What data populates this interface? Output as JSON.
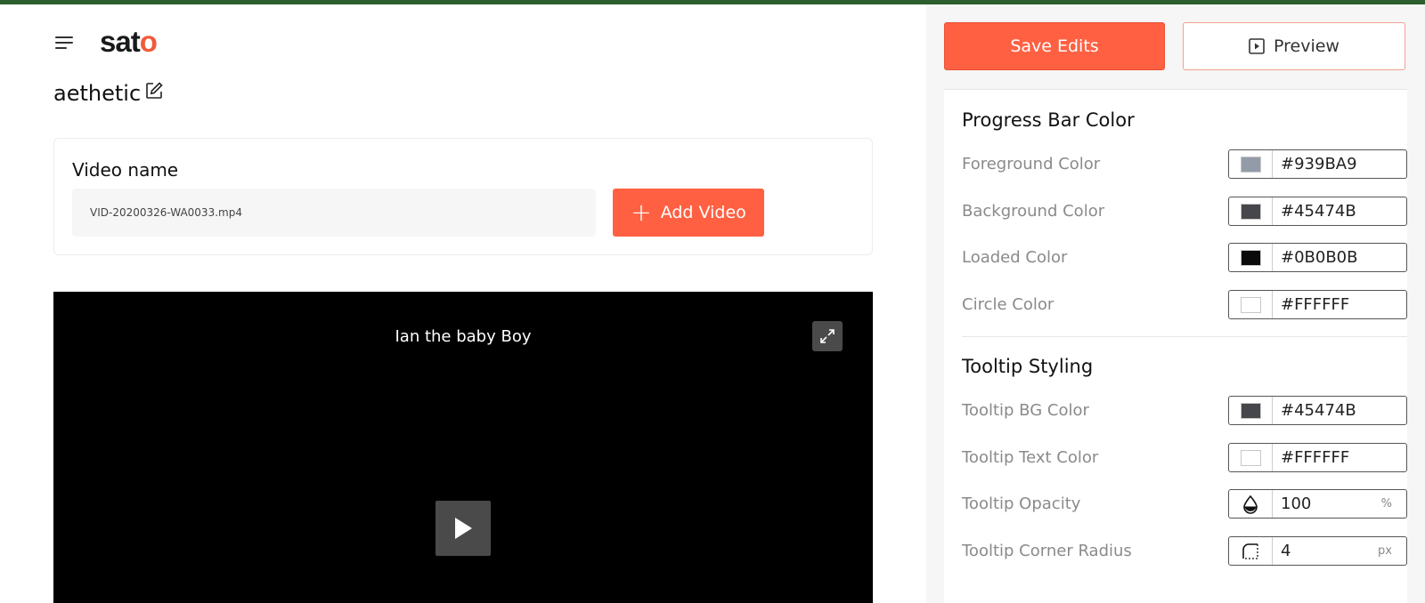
{
  "header": {
    "logo_prefix": "sat",
    "logo_suffix": "o",
    "project_name": "aethetic"
  },
  "video_card": {
    "label": "Video name",
    "file_value": "VID-20200326-WA0033.mp4",
    "add_button": "Add Video"
  },
  "player": {
    "title": "Ian the baby Boy"
  },
  "actions": {
    "save_label": "Save Edits",
    "preview_label": "Preview"
  },
  "progress_section": {
    "title": "Progress Bar Color",
    "rows": [
      {
        "label": "Foreground Color",
        "value": "#939BA9",
        "color": "#939BA9"
      },
      {
        "label": "Background Color",
        "value": "#45474B",
        "color": "#45474B"
      },
      {
        "label": "Loaded Color",
        "value": "#0B0B0B",
        "color": "#0B0B0B"
      },
      {
        "label": "Circle Color",
        "value": "#FFFFFF",
        "color": "#FFFFFF"
      }
    ]
  },
  "tooltip_section": {
    "title": "Tooltip Styling",
    "bg": {
      "label": "Tooltip BG Color",
      "value": "#45474B",
      "color": "#45474B"
    },
    "text": {
      "label": "Tooltip Text Color",
      "value": "#FFFFFF",
      "color": "#FFFFFF"
    },
    "opacity": {
      "label": "Tooltip Opacity",
      "value": "100",
      "unit": "%",
      "icon": "opacity-drop-icon"
    },
    "radius": {
      "label": "Tooltip Corner Radius",
      "value": "4",
      "unit": "px",
      "icon": "corner-radius-icon"
    }
  },
  "colors": {
    "accent": "#FF6042",
    "top_strip": "#2C5E2E"
  }
}
